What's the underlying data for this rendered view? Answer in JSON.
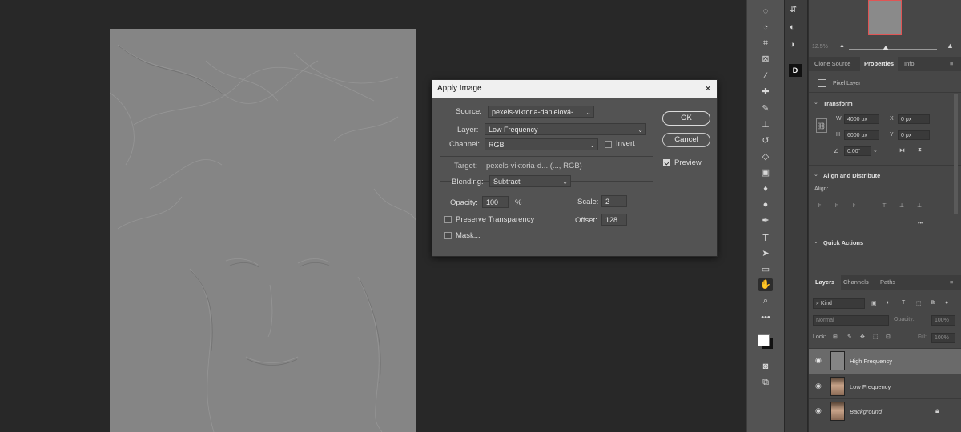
{
  "dialog": {
    "title": "Apply Image",
    "close": "×",
    "source_label": "Source:",
    "source_value": "pexels-viktoria-danielová-...",
    "layer_label": "Layer:",
    "layer_value": "Low Frequency",
    "channel_label": "Channel:",
    "channel_value": "RGB",
    "invert_label": "Invert",
    "invert_checked": false,
    "target_label": "Target:",
    "target_value": "pexels-viktoria-d... (..., RGB)",
    "blending_label": "Blending:",
    "blending_value": "Subtract",
    "opacity_label": "Opacity:",
    "opacity_value": "100",
    "opacity_unit": "%",
    "scale_label": "Scale:",
    "scale_value": "2",
    "offset_label": "Offset:",
    "offset_value": "128",
    "preserve_label": "Preserve Transparency",
    "mask_label": "Mask...",
    "ok_label": "OK",
    "cancel_label": "Cancel",
    "preview_label": "Preview",
    "preview_checked": true
  },
  "navigator": {
    "zoom": "12.5%"
  },
  "properties_panel": {
    "tabs": [
      "Clone Source",
      "Properties",
      "Info"
    ],
    "active_tab": "Properties",
    "layer_type": "Pixel Layer",
    "transform": {
      "title": "Transform",
      "w_label": "W",
      "w_value": "4000 px",
      "h_label": "H",
      "h_value": "6000 px",
      "x_label": "X",
      "x_value": "0 px",
      "y_label": "Y",
      "y_value": "0 px",
      "angle_value": "0.00°"
    },
    "align": {
      "title": "Align and Distribute",
      "align_label": "Align:",
      "more": "•••"
    },
    "quick_actions": "Quick Actions"
  },
  "layers_panel": {
    "tabs": [
      "Layers",
      "Channels",
      "Paths"
    ],
    "active_tab": "Layers",
    "kind_placeholder": "Kind",
    "blend_mode": "Normal",
    "opacity_label": "Opacity:",
    "opacity_value": "100%",
    "lock_label": "Lock:",
    "fill_label": "Fill:",
    "fill_value": "100%",
    "layers": [
      {
        "name": "High Frequency",
        "selected": true,
        "visible": true
      },
      {
        "name": "Low Frequency",
        "selected": false,
        "visible": true
      },
      {
        "name": "Background",
        "selected": false,
        "visible": true,
        "locked": true
      }
    ]
  },
  "colors": {
    "canvas_bg": "#282828",
    "document_gray": "#858585",
    "dialog_bg": "#535353",
    "panel_bg": "#474747",
    "navigator_frame": "#e05555"
  }
}
